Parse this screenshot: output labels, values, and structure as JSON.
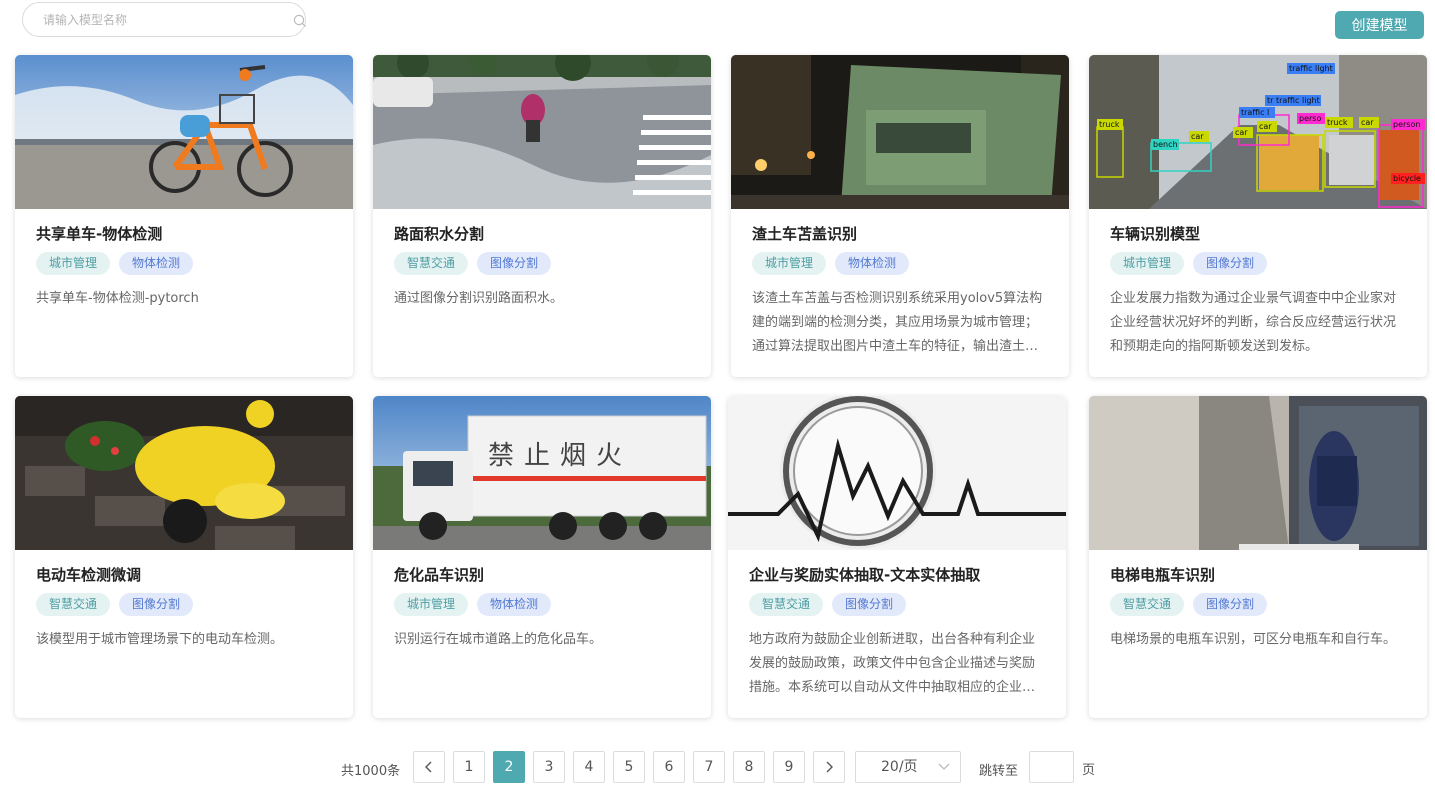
{
  "search": {
    "placeholder": "请输入模型名称",
    "icon": "search-icon"
  },
  "toolbar": {
    "create_label": "创建模型"
  },
  "colors": {
    "accent": "#4fa9b0",
    "tag_green_bg": "#e4f2f2",
    "tag_blue_bg": "#e1e9fb"
  },
  "cards": [
    {
      "title": "共享单车-物体检测",
      "tags": [
        "城市管理",
        "物体检测"
      ],
      "desc": "共享单车-物体检测-pytorch"
    },
    {
      "title": "路面积水分割",
      "tags": [
        "智慧交通",
        "图像分割"
      ],
      "desc": "通过图像分割识别路面积水。"
    },
    {
      "title": "渣土车苫盖识别",
      "tags": [
        "城市管理",
        "物体检测"
      ],
      "desc": "该渣土车苫盖与否检测识别系统采用yolov5算法构建的端到端的检测分类，其应用场景为城市管理；通过算法提取出图片中渣土车的特征，输出渣土车的位置与苫盖情况。"
    },
    {
      "title": "车辆识别模型",
      "tags": [
        "城市管理",
        "图像分割"
      ],
      "desc": "企业发展力指数为通过企业景气调查中中企业家对企业经营状况好坏的判断，综合反应经营运行状况和预期走向的指阿斯顿发送到发标。"
    },
    {
      "title": "电动车检测微调",
      "tags": [
        "智慧交通",
        "图像分割"
      ],
      "desc": "该模型用于城市管理场景下的电动车检测。"
    },
    {
      "title": "危化品车识别",
      "tags": [
        "城市管理",
        "物体检测"
      ],
      "desc": "识别运行在城市道路上的危化品车。",
      "truck_text": "禁止烟火"
    },
    {
      "title": "企业与奖励实体抽取-文本实体抽取",
      "tags": [
        "智慧交通",
        "图像分割"
      ],
      "desc": "地方政府为鼓励企业创新进取，出台各种有利企业发展的鼓励政策，政策文件中包含企业描述与奖励措施。本系统可以自动从文件中抽取相应的企业名称与奖励信息。"
    },
    {
      "title": "电梯电瓶车识别",
      "tags": [
        "智慧交通",
        "图像分割"
      ],
      "desc": "电梯场景的电瓶车识别，可区分电瓶车和自行车。"
    }
  ],
  "detection_labels": [
    "traffic light",
    "tr traffic light",
    "traffic l",
    "truck",
    "truck",
    "car",
    "car",
    "car",
    "car",
    "bench",
    "perso",
    "person",
    "bicycle"
  ],
  "pagination": {
    "total": "共1000条",
    "pages": [
      "1",
      "2",
      "3",
      "4",
      "5",
      "6",
      "7",
      "8",
      "9"
    ],
    "current": "2",
    "page_size": "20/页",
    "jump_label": "跳转至",
    "jump_suffix": "页"
  }
}
